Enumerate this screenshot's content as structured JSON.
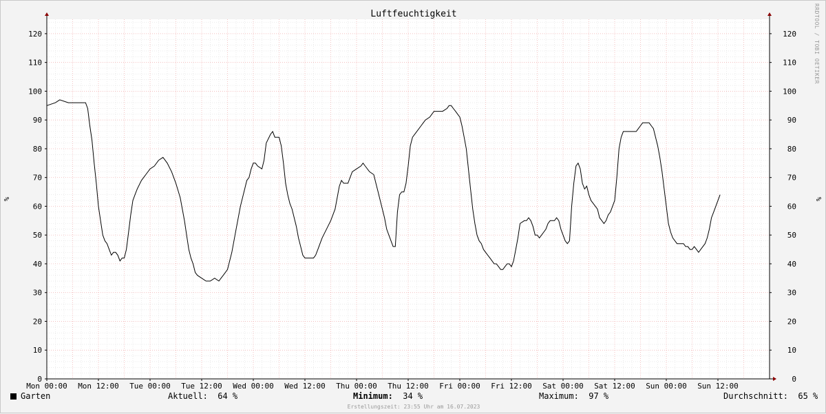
{
  "chart_data": {
    "type": "line",
    "title": "Luftfeuchtigkeit",
    "ylabel": "%",
    "ylim": [
      0,
      125
    ],
    "yticks": [
      0,
      10,
      20,
      30,
      40,
      50,
      60,
      70,
      80,
      90,
      100,
      110,
      120
    ],
    "xlim_hours": [
      0,
      168
    ],
    "xticks": [
      {
        "h": 0,
        "label": "Mon 00:00"
      },
      {
        "h": 12,
        "label": "Mon 12:00"
      },
      {
        "h": 24,
        "label": "Tue 00:00"
      },
      {
        "h": 36,
        "label": "Tue 12:00"
      },
      {
        "h": 48,
        "label": "Wed 00:00"
      },
      {
        "h": 60,
        "label": "Wed 12:00"
      },
      {
        "h": 72,
        "label": "Thu 00:00"
      },
      {
        "h": 84,
        "label": "Thu 12:00"
      },
      {
        "h": 96,
        "label": "Fri 00:00"
      },
      {
        "h": 108,
        "label": "Fri 12:00"
      },
      {
        "h": 120,
        "label": "Sat 00:00"
      },
      {
        "h": 132,
        "label": "Sat 12:00"
      },
      {
        "h": 144,
        "label": "Sun 00:00"
      },
      {
        "h": 156,
        "label": "Sun 12:00"
      }
    ],
    "grid": true,
    "series": [
      {
        "name": "Garten",
        "color": "#000000",
        "points": [
          [
            0,
            95
          ],
          [
            2,
            96
          ],
          [
            3,
            97
          ],
          [
            5,
            96
          ],
          [
            7,
            96
          ],
          [
            9,
            96
          ],
          [
            9.5,
            94
          ],
          [
            10,
            88
          ],
          [
            10.5,
            83
          ],
          [
            11,
            75
          ],
          [
            11.5,
            68
          ],
          [
            12,
            60
          ],
          [
            12.5,
            55
          ],
          [
            13,
            50
          ],
          [
            13.5,
            48
          ],
          [
            14,
            47
          ],
          [
            14.5,
            45
          ],
          [
            15,
            43
          ],
          [
            15.5,
            44
          ],
          [
            16,
            44
          ],
          [
            16.5,
            43
          ],
          [
            17,
            41
          ],
          [
            17.5,
            42
          ],
          [
            18,
            42
          ],
          [
            18.5,
            45
          ],
          [
            19,
            51
          ],
          [
            19.5,
            57
          ],
          [
            20,
            62
          ],
          [
            20.5,
            64
          ],
          [
            21,
            66
          ],
          [
            22,
            69
          ],
          [
            23,
            71
          ],
          [
            24,
            73
          ],
          [
            25,
            74
          ],
          [
            26,
            76
          ],
          [
            27,
            77
          ],
          [
            27.5,
            76
          ],
          [
            28,
            75
          ],
          [
            29,
            72
          ],
          [
            30,
            68
          ],
          [
            31,
            63
          ],
          [
            32,
            55
          ],
          [
            32.5,
            50
          ],
          [
            33,
            45
          ],
          [
            33.5,
            42
          ],
          [
            34,
            40
          ],
          [
            34.5,
            37
          ],
          [
            35,
            36
          ],
          [
            36,
            35
          ],
          [
            37,
            34
          ],
          [
            38,
            34
          ],
          [
            39,
            35
          ],
          [
            40,
            34
          ],
          [
            40.5,
            35
          ],
          [
            41,
            36
          ],
          [
            42,
            38
          ],
          [
            43,
            44
          ],
          [
            44,
            52
          ],
          [
            45,
            60
          ],
          [
            46,
            66
          ],
          [
            46.5,
            69
          ],
          [
            47,
            70
          ],
          [
            47.5,
            73
          ],
          [
            48,
            75
          ],
          [
            48.5,
            75
          ],
          [
            49,
            74
          ],
          [
            50,
            73
          ],
          [
            50.5,
            76
          ],
          [
            51,
            82
          ],
          [
            52,
            85
          ],
          [
            52.5,
            86
          ],
          [
            53,
            84
          ],
          [
            54,
            84
          ],
          [
            54.5,
            81
          ],
          [
            55,
            75
          ],
          [
            55.5,
            68
          ],
          [
            56,
            64
          ],
          [
            56.5,
            61
          ],
          [
            57,
            59
          ],
          [
            58,
            53
          ],
          [
            58.5,
            49
          ],
          [
            59,
            46
          ],
          [
            59.5,
            43
          ],
          [
            60,
            42
          ],
          [
            61,
            42
          ],
          [
            62,
            42
          ],
          [
            62.5,
            43
          ],
          [
            63,
            45
          ],
          [
            63.5,
            47
          ],
          [
            64,
            49
          ],
          [
            65,
            52
          ],
          [
            66,
            55
          ],
          [
            67,
            59
          ],
          [
            67.5,
            63
          ],
          [
            68,
            67
          ],
          [
            68.5,
            69
          ],
          [
            69,
            68
          ],
          [
            70,
            68
          ],
          [
            70.5,
            70
          ],
          [
            71,
            72
          ],
          [
            72,
            73
          ],
          [
            73,
            74
          ],
          [
            73.5,
            75
          ],
          [
            74,
            74
          ],
          [
            75,
            72
          ],
          [
            76,
            71
          ],
          [
            76.5,
            68
          ],
          [
            77,
            65
          ],
          [
            77.5,
            62
          ],
          [
            78,
            59
          ],
          [
            78.5,
            56
          ],
          [
            79,
            52
          ],
          [
            79.5,
            50
          ],
          [
            80,
            48
          ],
          [
            80.5,
            46
          ],
          [
            81,
            46
          ],
          [
            81.5,
            58
          ],
          [
            82,
            64
          ],
          [
            82.5,
            65
          ],
          [
            83,
            65
          ],
          [
            83.5,
            68
          ],
          [
            84,
            74
          ],
          [
            84.5,
            81
          ],
          [
            85,
            84
          ],
          [
            86,
            86
          ],
          [
            87,
            88
          ],
          [
            87.5,
            89
          ],
          [
            88,
            90
          ],
          [
            89,
            91
          ],
          [
            89.5,
            92
          ],
          [
            90,
            93
          ],
          [
            91,
            93
          ],
          [
            92,
            93
          ],
          [
            93,
            94
          ],
          [
            93.5,
            95
          ],
          [
            94,
            95
          ],
          [
            94.5,
            94
          ],
          [
            95,
            93
          ],
          [
            95.5,
            92
          ],
          [
            96,
            91
          ],
          [
            96.5,
            88
          ],
          [
            97,
            84
          ],
          [
            97.5,
            80
          ],
          [
            98,
            73
          ],
          [
            98.5,
            66
          ],
          [
            99,
            59
          ],
          [
            99.5,
            54
          ],
          [
            100,
            50
          ],
          [
            100.5,
            48
          ],
          [
            101,
            47
          ],
          [
            101.5,
            45
          ],
          [
            102,
            44
          ],
          [
            102.5,
            43
          ],
          [
            103,
            42
          ],
          [
            103.5,
            41
          ],
          [
            104,
            40
          ],
          [
            104.5,
            40
          ],
          [
            105,
            39
          ],
          [
            105.5,
            38
          ],
          [
            106,
            38
          ],
          [
            106.5,
            39
          ],
          [
            107,
            40
          ],
          [
            107.5,
            40
          ],
          [
            108,
            39
          ],
          [
            108.5,
            41
          ],
          [
            109,
            45
          ],
          [
            109.5,
            49
          ],
          [
            110,
            54
          ],
          [
            111,
            55
          ],
          [
            111.5,
            55
          ],
          [
            112,
            56
          ],
          [
            112.5,
            55
          ],
          [
            113,
            53
          ],
          [
            113.5,
            50
          ],
          [
            114,
            50
          ],
          [
            114.5,
            49
          ],
          [
            115,
            50
          ],
          [
            115.5,
            51
          ],
          [
            116,
            52
          ],
          [
            116.5,
            54
          ],
          [
            117,
            55
          ],
          [
            118,
            55
          ],
          [
            118.5,
            56
          ],
          [
            119,
            55
          ],
          [
            119.5,
            52
          ],
          [
            120,
            50
          ],
          [
            120.5,
            48
          ],
          [
            121,
            47
          ],
          [
            121.5,
            48
          ],
          [
            122,
            60
          ],
          [
            122.5,
            68
          ],
          [
            123,
            74
          ],
          [
            123.5,
            75
          ],
          [
            124,
            73
          ],
          [
            124.5,
            68
          ],
          [
            125,
            66
          ],
          [
            125.5,
            67
          ],
          [
            126,
            64
          ],
          [
            126.5,
            62
          ],
          [
            127,
            61
          ],
          [
            127.5,
            60
          ],
          [
            128,
            59
          ],
          [
            128.5,
            56
          ],
          [
            129,
            55
          ],
          [
            129.5,
            54
          ],
          [
            130,
            55
          ],
          [
            130.5,
            57
          ],
          [
            131,
            58
          ],
          [
            131.5,
            60
          ],
          [
            132,
            62
          ],
          [
            132.5,
            70
          ],
          [
            133,
            80
          ],
          [
            133.5,
            84
          ],
          [
            134,
            86
          ],
          [
            135,
            86
          ],
          [
            136,
            86
          ],
          [
            137,
            86
          ],
          [
            137.5,
            87
          ],
          [
            138,
            88
          ],
          [
            138.5,
            89
          ],
          [
            139,
            89
          ],
          [
            140,
            89
          ],
          [
            140.5,
            88
          ],
          [
            141,
            87
          ],
          [
            141.5,
            84
          ],
          [
            142,
            81
          ],
          [
            142.5,
            77
          ],
          [
            143,
            72
          ],
          [
            143.5,
            66
          ],
          [
            144,
            60
          ],
          [
            144.5,
            54
          ],
          [
            145,
            51
          ],
          [
            145.5,
            49
          ],
          [
            146,
            48
          ],
          [
            146.5,
            47
          ],
          [
            147,
            47
          ],
          [
            148,
            47
          ],
          [
            148.5,
            46
          ],
          [
            149,
            46
          ],
          [
            149.5,
            45
          ],
          [
            150,
            45
          ],
          [
            150.5,
            46
          ],
          [
            151,
            45
          ],
          [
            151.5,
            44
          ],
          [
            152,
            45
          ],
          [
            152.5,
            46
          ],
          [
            153,
            47
          ],
          [
            153.5,
            49
          ],
          [
            154,
            52
          ],
          [
            154.5,
            56
          ],
          [
            155,
            58
          ],
          [
            155.5,
            60
          ],
          [
            156,
            62
          ],
          [
            156.5,
            64
          ]
        ]
      }
    ],
    "legend": {
      "series_label": "Garten",
      "current_label": "Aktuell:",
      "current_value": "64 %",
      "min_label": "Minimum:",
      "min_value": "34 %",
      "max_label": "Maximum:",
      "max_value": "97 %",
      "avg_label": "Durchschnitt:",
      "avg_value": "65 %"
    },
    "footer": "Erstellungszeit: 23:55 Uhr am 16.07.2023",
    "credit": "RRDTOOL / TOBI OETIKER"
  }
}
